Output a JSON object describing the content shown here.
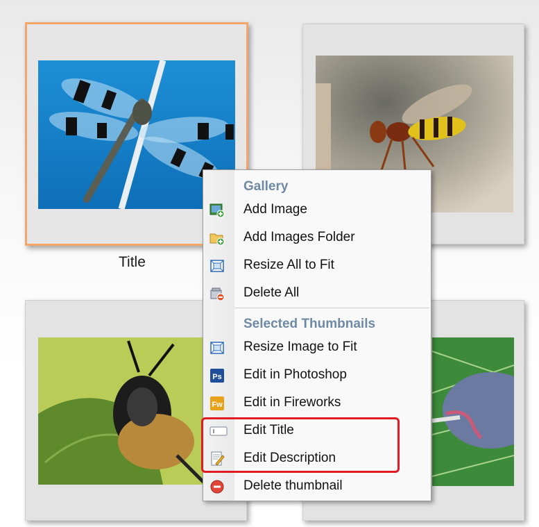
{
  "thumbnails": [
    {
      "id": "dragonfly",
      "title": "Title",
      "selected": true
    },
    {
      "id": "wasp",
      "title": "",
      "selected": false
    },
    {
      "id": "bee",
      "title": "",
      "selected": false
    },
    {
      "id": "leaf",
      "title": "",
      "selected": false
    }
  ],
  "context_menu": {
    "gallery_header": "Gallery",
    "gallery_items": [
      {
        "label": "Add Image",
        "icon": "add-image-icon"
      },
      {
        "label": "Add Images Folder",
        "icon": "add-folder-icon"
      },
      {
        "label": "Resize All to Fit",
        "icon": "resize-icon"
      },
      {
        "label": "Delete All",
        "icon": "delete-all-icon"
      }
    ],
    "selected_header": "Selected Thumbnails",
    "selected_items": [
      {
        "label": "Resize Image to Fit",
        "icon": "resize-icon"
      },
      {
        "label": "Edit in Photoshop",
        "icon": "photoshop-icon",
        "badge": "Ps"
      },
      {
        "label": "Edit in Fireworks",
        "icon": "fireworks-icon",
        "badge": "Fw"
      },
      {
        "label": "Edit Title",
        "icon": "title-field-icon"
      },
      {
        "label": "Edit Description",
        "icon": "edit-description-icon"
      },
      {
        "label": "Delete thumbnail",
        "icon": "delete-icon"
      }
    ]
  },
  "colors": {
    "selected_border": "#f2a66a",
    "menu_header": "#6e89a3",
    "highlight": "#e01b24"
  }
}
